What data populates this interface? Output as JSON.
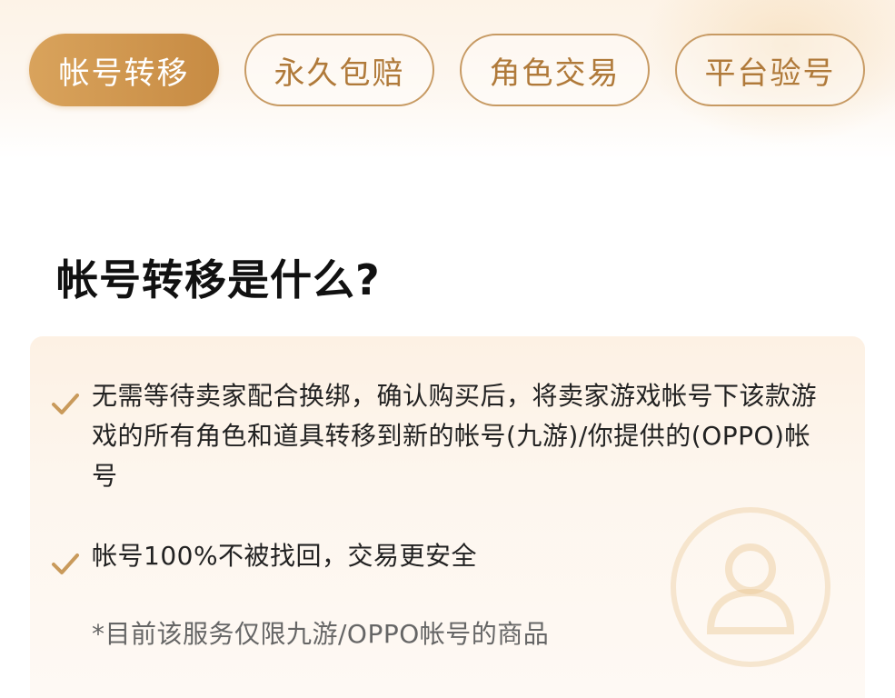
{
  "tabs": [
    {
      "label": "帐号转移",
      "active": true
    },
    {
      "label": "永久包赔",
      "active": false
    },
    {
      "label": "角色交易",
      "active": false
    },
    {
      "label": "平台验号",
      "active": false
    }
  ],
  "title": "帐号转移是什么?",
  "bullets": [
    {
      "icon": "check-icon",
      "text": "无需等待卖家配合换绑，确认购买后，将卖家游戏帐号下该款游戏的所有角色和道具转移到新的帐号(九游)/你提供的(OPPO)帐号"
    },
    {
      "icon": "check-icon",
      "text": "帐号100%不被找回，交易更安全"
    }
  ],
  "note": "*目前该服务仅限九游/OPPO帐号的商品",
  "watermark_icon": "user-shield-icon",
  "colors": {
    "accent": "#c78b43",
    "tab_border": "#c79a63",
    "tab_text": "#b07a3a",
    "title": "#111111",
    "card_bg": "#fdf4ea"
  }
}
